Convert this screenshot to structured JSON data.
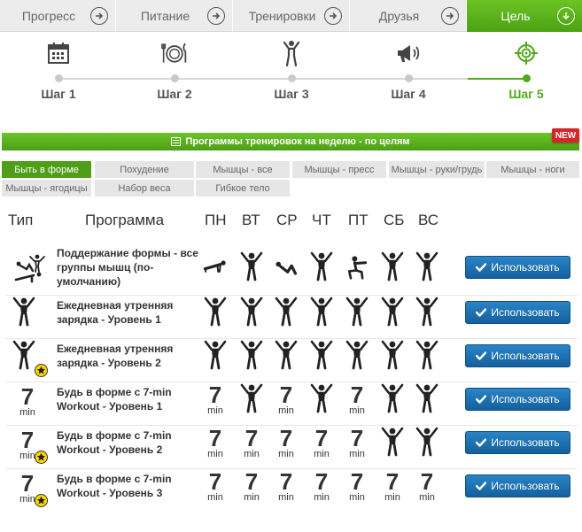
{
  "nav": {
    "tabs": [
      {
        "label": "Прогресс",
        "active": false,
        "icon": "arrow-right-circle-icon"
      },
      {
        "label": "Питание",
        "active": false,
        "icon": "arrow-right-circle-icon"
      },
      {
        "label": "Тренировки",
        "active": false,
        "icon": "arrow-right-circle-icon"
      },
      {
        "label": "Друзья",
        "active": false,
        "icon": "arrow-right-circle-icon"
      },
      {
        "label": "Цель",
        "active": true,
        "icon": "arrow-down-circle-icon"
      }
    ]
  },
  "steps": [
    {
      "label": "Шаг 1",
      "icon": "calendar-icon",
      "active": false
    },
    {
      "label": "Шаг 2",
      "icon": "plate-cutlery-icon",
      "active": false
    },
    {
      "label": "Шаг 3",
      "icon": "person-icon",
      "active": false
    },
    {
      "label": "Шаг 4",
      "icon": "megaphone-icon",
      "active": false
    },
    {
      "label": "Шаг 5",
      "icon": "target-icon",
      "active": true
    }
  ],
  "banner": {
    "title": "Программы тренировок на неделю - по целям",
    "badge": "NEW"
  },
  "filters": [
    {
      "label": "Быть в форме",
      "active": true
    },
    {
      "label": "Похудение",
      "active": false
    },
    {
      "label": "Мышцы - все",
      "active": false
    },
    {
      "label": "Мышцы - пресс",
      "active": false
    },
    {
      "label": "Мышцы - руки/грудь",
      "active": false
    },
    {
      "label": "Мышцы - ноги",
      "active": false
    },
    {
      "label": "Мышцы - ягодицы",
      "active": false
    },
    {
      "label": "Набор веса",
      "active": false
    },
    {
      "label": "Гибкое тело",
      "active": false
    }
  ],
  "table": {
    "headers": {
      "type": "Тип",
      "program": "Программа",
      "days": [
        "ПН",
        "ВТ",
        "СР",
        "ЧТ",
        "ПТ",
        "СБ",
        "ВС"
      ]
    },
    "seven_number": "7",
    "seven_unit": "min",
    "use_label": "Использовать",
    "rows": [
      {
        "type": "mixed",
        "premium": false,
        "name": "Поддержание формы - все группы мышц (по-умолчанию)",
        "days": [
          "pushup",
          "jack",
          "crunch",
          "jack",
          "squat",
          "jack",
          "jack"
        ]
      },
      {
        "type": "jack",
        "premium": false,
        "name": "Ежедневная утренняя зарядка - Уровень 1",
        "days": [
          "jack",
          "jack",
          "jack",
          "jack",
          "jack",
          "jack",
          "jack"
        ]
      },
      {
        "type": "jack",
        "premium": true,
        "name": "Ежедневная утренняя зарядка - Уровень 2",
        "days": [
          "jack",
          "jack",
          "jack",
          "jack",
          "jack",
          "jack",
          "jack"
        ]
      },
      {
        "type": "seven",
        "premium": false,
        "name": "Будь в форме с 7-min Workout - Уровень 1",
        "days": [
          "seven",
          "jack",
          "seven",
          "jack",
          "seven",
          "jack",
          "jack"
        ]
      },
      {
        "type": "seven",
        "premium": true,
        "name": "Будь в форме с 7-min Workout - Уровень 2",
        "days": [
          "seven",
          "seven",
          "seven",
          "seven",
          "seven",
          "jack",
          "jack"
        ]
      },
      {
        "type": "seven",
        "premium": true,
        "name": "Будь в форме с 7-min Workout - Уровень 3",
        "days": [
          "seven",
          "seven",
          "seven",
          "seven",
          "seven",
          "seven",
          "seven"
        ]
      }
    ]
  },
  "colors": {
    "accent": "#53a81b",
    "button": "#1b6fb2",
    "badge": "#d7262b",
    "star": "#fcd800"
  }
}
